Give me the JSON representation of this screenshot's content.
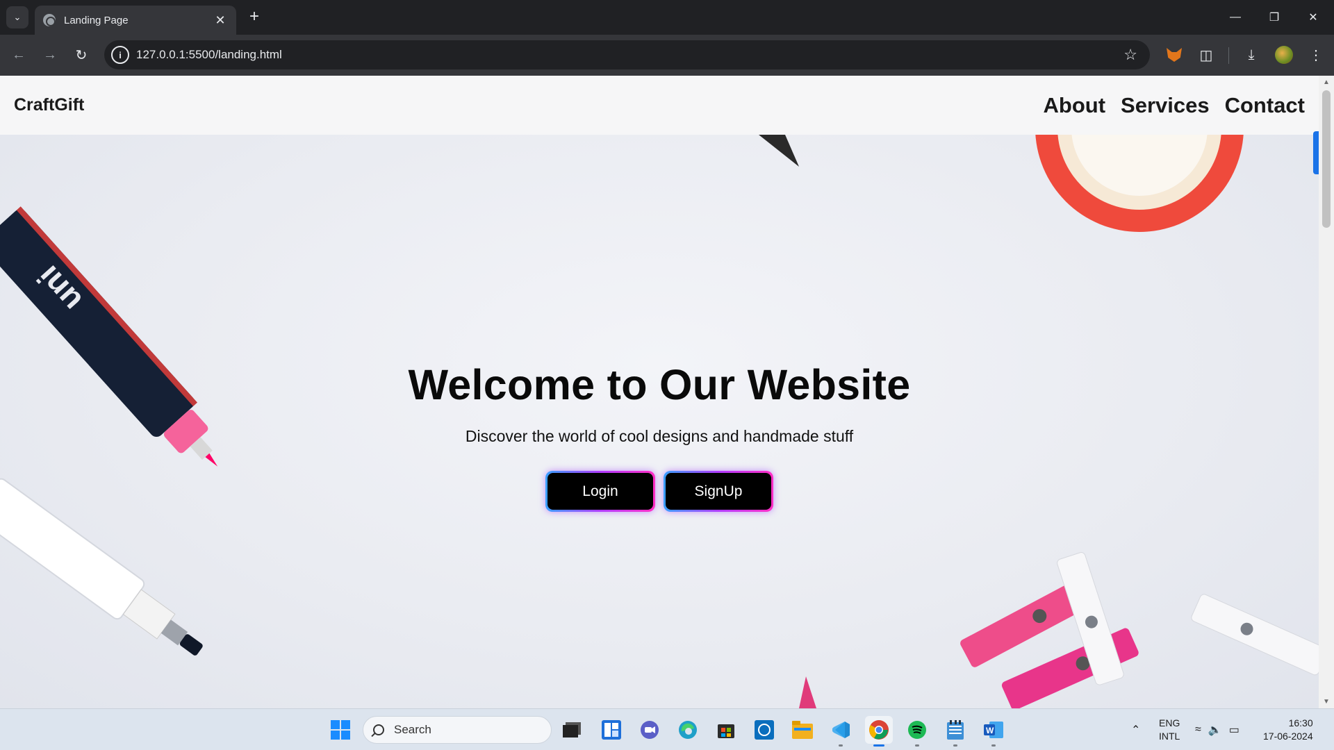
{
  "browser": {
    "tab_title": "Landing Page",
    "url": "127.0.0.1:5500/landing.html"
  },
  "page": {
    "brand": "CraftGift",
    "nav": [
      "About",
      "Services",
      "Contact"
    ],
    "hero_title": "Welcome to Our Website",
    "hero_subtitle": "Discover the world of cool designs and handmade stuff",
    "login_label": "Login",
    "signup_label": "SignUp"
  },
  "taskbar": {
    "search_placeholder": "Search",
    "language": "ENG",
    "layout": "INTL",
    "time": "16:30",
    "date": "17-06-2024"
  }
}
